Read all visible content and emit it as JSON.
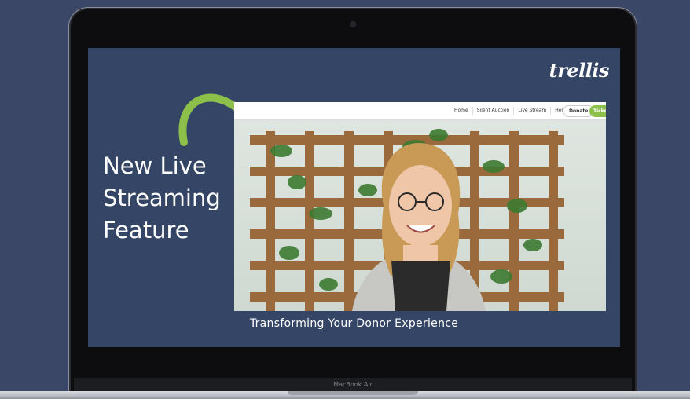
{
  "brand": {
    "logo_text": "trellis"
  },
  "headline": {
    "line1": "New Live",
    "line2": "Streaming",
    "line3": "Feature"
  },
  "video_nav": {
    "links": [
      "Home",
      "Silent Auction",
      "Live Stream",
      "Help"
    ],
    "help_icon_glyph": "?",
    "donate_label": "Donate",
    "tickets_label": "Tickets"
  },
  "caption": "Transforming Your Donor Experience",
  "device": {
    "model_label": "MacBook Air"
  },
  "colors": {
    "background": "#3a4766",
    "screen": "#344566",
    "accent_green": "#8cc04b"
  }
}
